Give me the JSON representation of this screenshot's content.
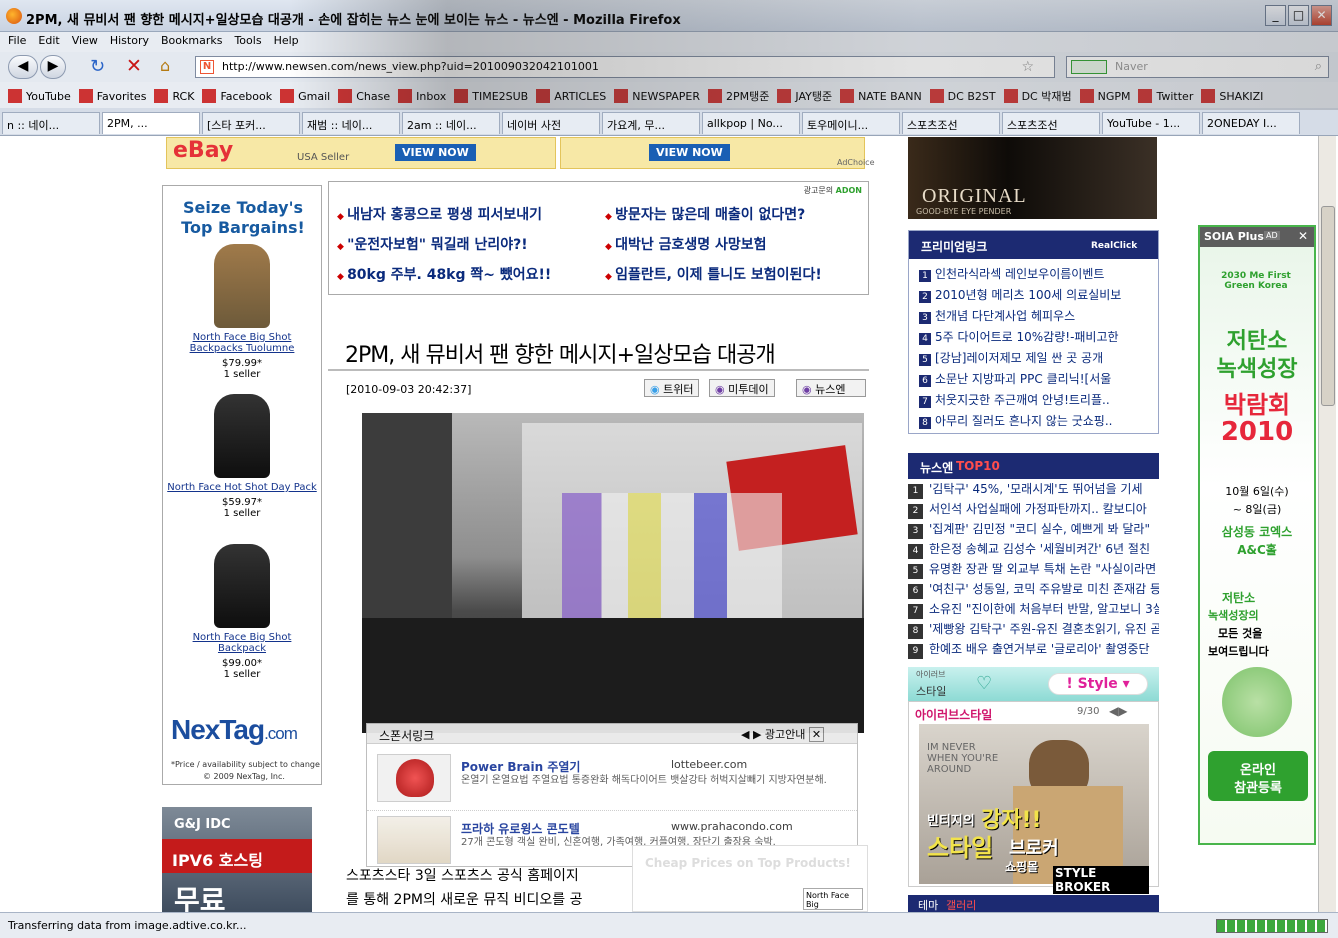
{
  "window": {
    "title": "2PM, 새 뮤비서 팬 향한 메시지+일상모습 대공개 - 손에 잡히는 뉴스 눈에 보이는 뉴스 - 뉴스엔 - Mozilla Firefox",
    "controls": [
      "_",
      "□",
      "✕"
    ]
  },
  "menu": [
    "File",
    "Edit",
    "View",
    "History",
    "Bookmarks",
    "Tools",
    "Help"
  ],
  "nav": {
    "url": "http://www.newsen.com/news_view.php?uid=201009032042101001",
    "search_placeholder": "Naver"
  },
  "bookmarks": [
    "YouTube",
    "Favorites",
    "RCK",
    "Facebook",
    "Gmail",
    "Chase",
    "Inbox",
    "TIME2SUB",
    "ARTICLES",
    "NEWSPAPER",
    "2PM탱준",
    "JAY탱준",
    "NATE BANN",
    "DC B2ST",
    "DC 박재범",
    "NGPM",
    "Twitter",
    "SHAKIZI"
  ],
  "tabs": [
    "n :: 네이...",
    "2PM, ...",
    "[스타 포커...",
    "재범 :: 네이...",
    "2am :: 네이...",
    "네이버 사전",
    "가요계, 무...",
    "allkpop | No...",
    "토우메이니...",
    "스포츠조선",
    "스포츠조선",
    "YouTube - 1...",
    "2ONEDAY I..."
  ],
  "top_ads": {
    "ebay_cta": "VIEW NOW",
    "ebay_cta2": "VIEW NOW",
    "ebay_seller": "USA Seller",
    "adchoice": "AdChoice",
    "cosmetic_brand": "ORIGINAL",
    "cosmetic_sub": "GOOD-BYE EYE PENDER"
  },
  "ad_links": {
    "label": "광고문의",
    "brand": "ADON",
    "items": [
      "내남자 홍콩으로 평생 피서보내기",
      "방문자는 많은데 매출이 없다면?",
      "\"운전자보험\" 뭐길래 난리야?!",
      "대박난 금호생명 사망보험",
      "80kg 주부. 48kg 쫙~ 뺐어요!!",
      "임플란트, 이제 틀니도 보험이된다!"
    ]
  },
  "article": {
    "headline": "2PM, 새 뮤비서 팬 향한 메시지+일상모습 대공개",
    "date": "[2010-09-03 20:42:37]",
    "share": [
      "트위터",
      "미투데이",
      "뉴스엔"
    ],
    "body1": "스포츠스타 3일 스포츠스 공식 홈페이지",
    "body2": "를 통해 2PM의 새로운 뮤직 비디오를 공"
  },
  "sponsor": {
    "title": "스폰서링크",
    "guide": "광고안내",
    "items": [
      {
        "name": "Power Brain 주열기",
        "url": "lottebeer.com",
        "desc": "온열기 온열요법 주열요법 통증완화 해독다이어트 뱃살강타 허벅지살빼기 지방자연분해."
      },
      {
        "name": "프라하 유로윙스 콘도텔",
        "url": "www.prahacondo.com",
        "desc": "27개 콘도형 객실 완비, 신혼여행, 가족여행, 커플여행, 장단기 출장용 숙박."
      }
    ],
    "cheap": "Cheap Prices on Top Products!",
    "north": "North Face Big"
  },
  "nextag": {
    "headline": "Seize Today's Top Bargains!",
    "products": [
      {
        "name": "North Face Big Shot Backpacks Tuolumne",
        "price": "$79.99*",
        "sellers": "1 seller"
      },
      {
        "name": "North Face Hot Shot Day Pack",
        "price": "$59.97*",
        "sellers": "1 seller"
      },
      {
        "name": "North Face Big Shot Backpack",
        "price": "$99.00*",
        "sellers": "1 seller"
      }
    ],
    "logo": "NexTag",
    "logo_suffix": ".com",
    "note": "*Price / availability subject to change",
    "copyright": "© 2009 NexTag, Inc."
  },
  "idc": {
    "brand": "G&J IDC",
    "line1": "IPV6 호스팅",
    "line2": "무료"
  },
  "premium": {
    "title": "프리미엄링크",
    "brand": "RealClick",
    "items": [
      "인천라식라섹 레인보우이름이벤트",
      "2010년형 메리츠 100세 의료실비보",
      "천개념 다단계사업 헤피우스",
      "5주 다이어트로 10%감량!-패비고한",
      "[강남]레이저제모 제일 싼 곳 공개",
      "소문난 지방파괴 PPC 클리닉![서울",
      "처웃지긋한 주근깨여 안녕!트리플..",
      "아무리 질러도 흔나지 않는 굿쇼핑.."
    ]
  },
  "top10": {
    "title_a": "뉴스엔",
    "title_b": "TOP10",
    "items": [
      "'김탁구' 45%, '모래시계'도 뛰어넘을 기세",
      "서인석 사업실패에 가정파탄까지.. 칼보디아",
      "'집계판' 김민정 \"코디 실수, 예쁘게 봐 달라\"",
      "한은정 송혜교 김성수 '세월비켜간' 6년 절친",
      "유명환 장관 딸 외교부 특채 논란 \"사실이라면",
      "'여친구' 성동일, 코믹 주유발로 미친 존재감 등",
      "소유진 \"진이한에 처음부터 반말, 알고보니 3살",
      "'제빵왕 김탁구' 주원-유진 결혼초읽기, 유진 곧",
      "한예조 배우 출연거부로 '글로리아' 촬영중단"
    ]
  },
  "style": {
    "label_small": "아이러브",
    "label": "스타일",
    "pill": "Style",
    "brand": "아이러브스타일",
    "page": "9/30",
    "img_text1": "빈티지의",
    "img_text2": "강자!!",
    "img_text3": "스타일",
    "img_text4": "브로커",
    "img_text5": "쇼핑몰",
    "img_text6": "STYLE BROKER",
    "img_text7": "IM NEVER WHEN YOU'RE AROUND"
  },
  "theme": {
    "a": "테마",
    "b": "갤러리"
  },
  "soia": {
    "title": "SOIA Plus",
    "ad": "AD",
    "logo": "2030 Me First Green Korea",
    "h1": "저탄소",
    "h2": "녹색성장",
    "h3": "박람회",
    "h4": "2010",
    "d1": "10월 6일(수)",
    "d2": "~ 8일(금)",
    "venue1": "삼성동 코엑스",
    "venue2": "A&C홀",
    "quote1": "저탄소",
    "quote2": "녹색성장의",
    "quote3": "모든 것을",
    "quote4": "보여드립니다",
    "cta1": "온라인",
    "cta2": "참관등록"
  },
  "status": {
    "text": "Transferring data from image.adtive.co.kr..."
  },
  "colors": {
    "accent": "#1c2a72",
    "link": "#0a2a7c",
    "red": "#c00000",
    "green": "#2fa12f"
  }
}
